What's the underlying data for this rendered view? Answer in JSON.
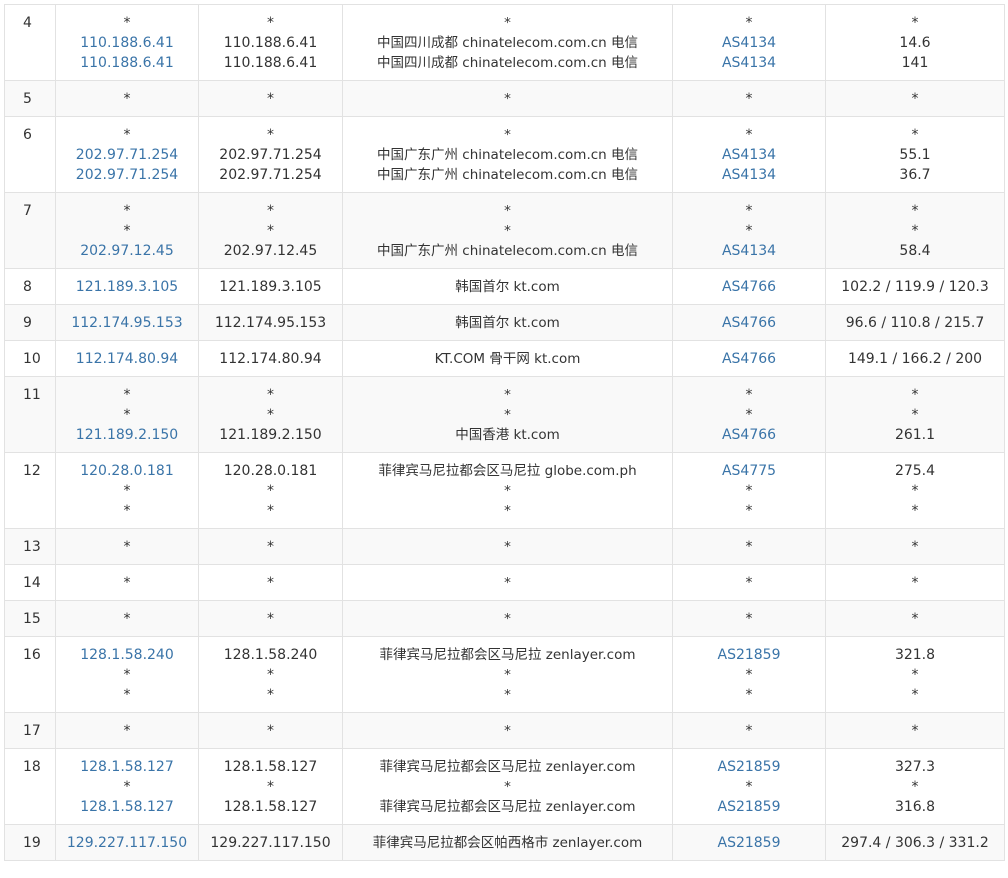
{
  "table": {
    "rows": [
      {
        "hop": "4",
        "ip": [
          "*",
          "110.188.6.41",
          "110.188.6.41"
        ],
        "host": [
          "*",
          "110.188.6.41",
          "110.188.6.41"
        ],
        "geo": [
          "*",
          "中国四川成都 chinatelecom.com.cn 电信",
          "中国四川成都 chinatelecom.com.cn 电信"
        ],
        "asn": [
          "*",
          "AS4134",
          "AS4134"
        ],
        "rtt": [
          "*",
          "14.6",
          "141"
        ]
      },
      {
        "hop": "5",
        "ip": [
          "*"
        ],
        "host": [
          "*"
        ],
        "geo": [
          "*"
        ],
        "asn": [
          "*"
        ],
        "rtt": [
          "*"
        ]
      },
      {
        "hop": "6",
        "ip": [
          "*",
          "202.97.71.254",
          "202.97.71.254"
        ],
        "host": [
          "*",
          "202.97.71.254",
          "202.97.71.254"
        ],
        "geo": [
          "*",
          "中国广东广州 chinatelecom.com.cn 电信",
          "中国广东广州 chinatelecom.com.cn 电信"
        ],
        "asn": [
          "*",
          "AS4134",
          "AS4134"
        ],
        "rtt": [
          "*",
          "55.1",
          "36.7"
        ]
      },
      {
        "hop": "7",
        "ip": [
          "*",
          "*",
          "202.97.12.45"
        ],
        "host": [
          "*",
          "*",
          "202.97.12.45"
        ],
        "geo": [
          "*",
          "*",
          "中国广东广州 chinatelecom.com.cn 电信"
        ],
        "asn": [
          "*",
          "*",
          "AS4134"
        ],
        "rtt": [
          "*",
          "*",
          "58.4"
        ]
      },
      {
        "hop": "8",
        "ip": [
          "121.189.3.105"
        ],
        "host": [
          "121.189.3.105"
        ],
        "geo": [
          "韩国首尔 kt.com"
        ],
        "asn": [
          "AS4766"
        ],
        "rtt": [
          "102.2 / 119.9 / 120.3"
        ]
      },
      {
        "hop": "9",
        "ip": [
          "112.174.95.153"
        ],
        "host": [
          "112.174.95.153"
        ],
        "geo": [
          "韩国首尔 kt.com"
        ],
        "asn": [
          "AS4766"
        ],
        "rtt": [
          "96.6 / 110.8 / 215.7"
        ]
      },
      {
        "hop": "10",
        "ip": [
          "112.174.80.94"
        ],
        "host": [
          "112.174.80.94"
        ],
        "geo": [
          "KT.COM 骨干网 kt.com"
        ],
        "asn": [
          "AS4766"
        ],
        "rtt": [
          "149.1 / 166.2 / 200"
        ]
      },
      {
        "hop": "11",
        "ip": [
          "*",
          "*",
          "121.189.2.150"
        ],
        "host": [
          "*",
          "*",
          "121.189.2.150"
        ],
        "geo": [
          "*",
          "*",
          "中国香港 kt.com"
        ],
        "asn": [
          "*",
          "*",
          "AS4766"
        ],
        "rtt": [
          "*",
          "*",
          "261.1"
        ]
      },
      {
        "hop": "12",
        "ip": [
          "120.28.0.181",
          "*",
          "*"
        ],
        "host": [
          "120.28.0.181",
          "*",
          "*"
        ],
        "geo": [
          "菲律宾马尼拉都会区马尼拉 globe.com.ph",
          "*",
          "*"
        ],
        "asn": [
          "AS4775",
          "*",
          "*"
        ],
        "rtt": [
          "275.4",
          "*",
          "*"
        ]
      },
      {
        "hop": "13",
        "ip": [
          "*"
        ],
        "host": [
          "*"
        ],
        "geo": [
          "*"
        ],
        "asn": [
          "*"
        ],
        "rtt": [
          "*"
        ]
      },
      {
        "hop": "14",
        "ip": [
          "*"
        ],
        "host": [
          "*"
        ],
        "geo": [
          "*"
        ],
        "asn": [
          "*"
        ],
        "rtt": [
          "*"
        ]
      },
      {
        "hop": "15",
        "ip": [
          "*"
        ],
        "host": [
          "*"
        ],
        "geo": [
          "*"
        ],
        "asn": [
          "*"
        ],
        "rtt": [
          "*"
        ]
      },
      {
        "hop": "16",
        "ip": [
          "128.1.58.240",
          "*",
          "*"
        ],
        "host": [
          "128.1.58.240",
          "*",
          "*"
        ],
        "geo": [
          "菲律宾马尼拉都会区马尼拉 zenlayer.com",
          "*",
          "*"
        ],
        "asn": [
          "AS21859",
          "*",
          "*"
        ],
        "rtt": [
          "321.8",
          "*",
          "*"
        ]
      },
      {
        "hop": "17",
        "ip": [
          "*"
        ],
        "host": [
          "*"
        ],
        "geo": [
          "*"
        ],
        "asn": [
          "*"
        ],
        "rtt": [
          "*"
        ]
      },
      {
        "hop": "18",
        "ip": [
          "128.1.58.127",
          "*",
          "128.1.58.127"
        ],
        "host": [
          "128.1.58.127",
          "*",
          "128.1.58.127"
        ],
        "geo": [
          "菲律宾马尼拉都会区马尼拉 zenlayer.com",
          "*",
          "菲律宾马尼拉都会区马尼拉 zenlayer.com"
        ],
        "asn": [
          "AS21859",
          "*",
          "AS21859"
        ],
        "rtt": [
          "327.3",
          "*",
          "316.8"
        ]
      },
      {
        "hop": "19",
        "ip": [
          "129.227.117.150"
        ],
        "host": [
          "129.227.117.150"
        ],
        "geo": [
          "菲律宾马尼拉都会区帕西格市 zenlayer.com"
        ],
        "asn": [
          "AS21859"
        ],
        "rtt": [
          "297.4 / 306.3 / 331.2"
        ]
      }
    ]
  }
}
